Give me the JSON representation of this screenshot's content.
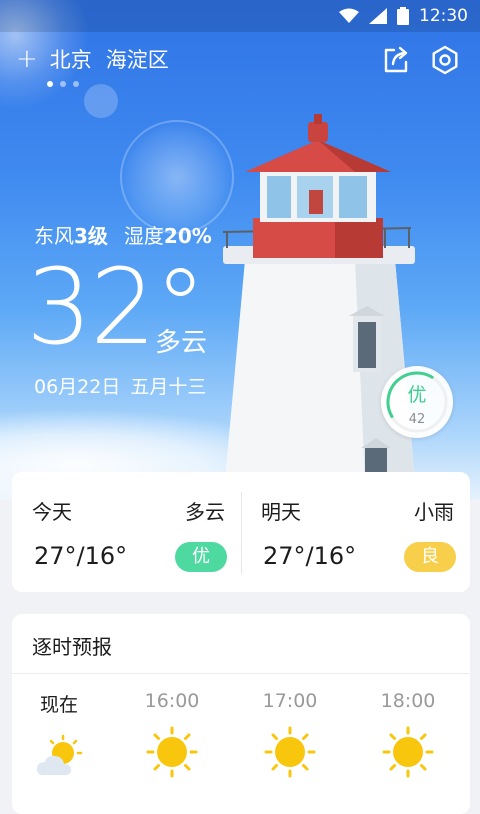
{
  "status_bar": {
    "time": "12:30",
    "icons": [
      "wifi-icon",
      "signal-icon",
      "battery-icon"
    ]
  },
  "location": {
    "city": "北京",
    "district": "海淀区",
    "add_glyph": "+",
    "page_count": 3,
    "active_page": 1
  },
  "current": {
    "wind_label": "东风",
    "wind_value": "3级",
    "humidity_label": "湿度",
    "humidity_value": "20%",
    "temperature": "32°",
    "condition": "多云",
    "date": "06月22日",
    "lunar_date": "五月十三",
    "aqi_level": "优",
    "aqi_value": "42",
    "aqi_fraction": 0.42,
    "aqi_color": "#3fcf8e"
  },
  "forecast": [
    {
      "name": "今天",
      "condition": "多云",
      "range": "27°/16°",
      "aqi": "优",
      "aqi_color": "#4ed9a1"
    },
    {
      "name": "明天",
      "condition": "小雨",
      "range": "27°/16°",
      "aqi": "良",
      "aqi_color": "#f8cf4a"
    }
  ],
  "hourly": {
    "title": "逐时预报",
    "items": [
      {
        "time": "现在",
        "icon": "partly-cloudy-icon"
      },
      {
        "time": "16:00",
        "icon": "sun-icon"
      },
      {
        "time": "17:00",
        "icon": "sun-icon"
      },
      {
        "time": "18:00",
        "icon": "sun-icon"
      }
    ]
  }
}
